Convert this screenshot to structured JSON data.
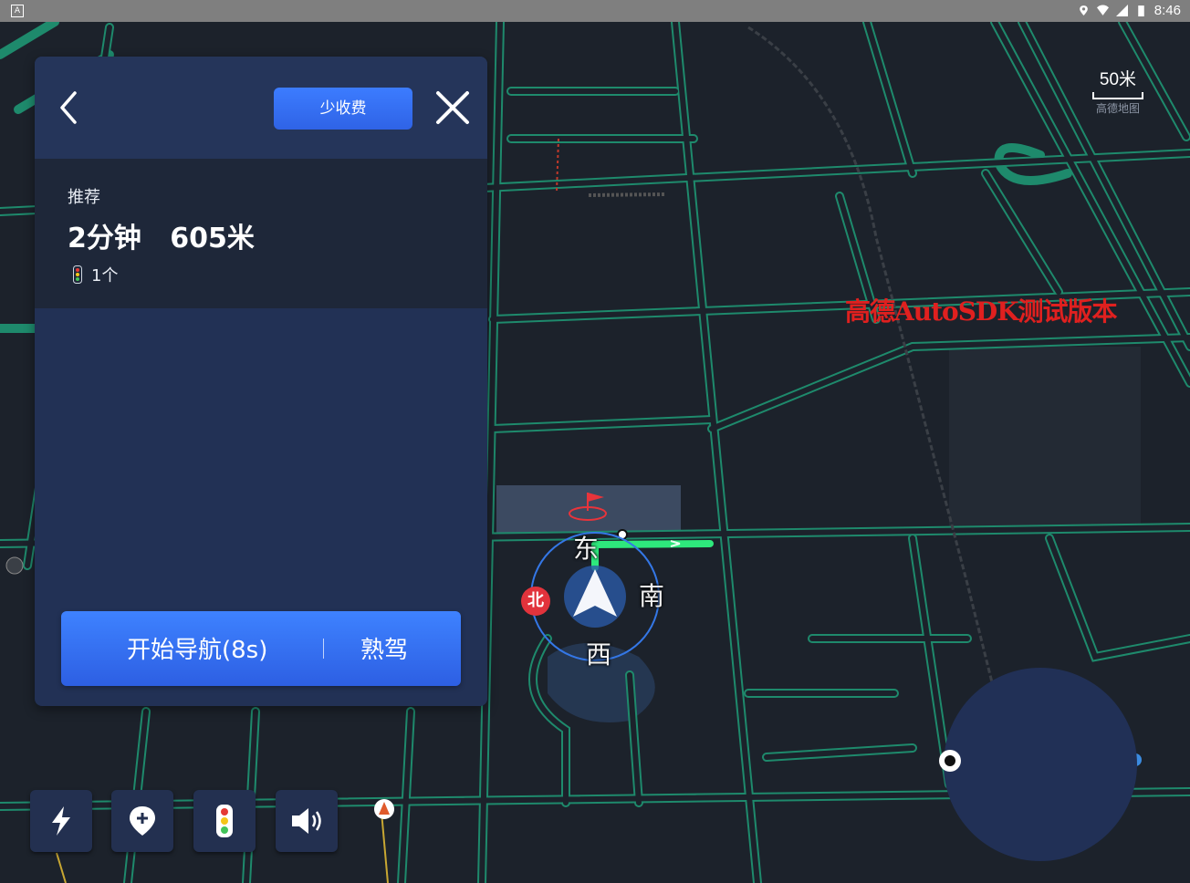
{
  "status_bar": {
    "time": "8:46",
    "icons": [
      "location-icon",
      "wifi-icon",
      "signal-icon",
      "battery-icon"
    ]
  },
  "route_panel": {
    "toll_option": "少收费",
    "route": {
      "tag": "推荐",
      "duration": "2分钟",
      "distance": "605米",
      "traffic_lights": "1个"
    },
    "nav_button": {
      "start_label": "开始导航(8s)",
      "familiar_label": "熟驾"
    }
  },
  "map": {
    "scale_value": "50米",
    "brand": "高德地图",
    "watermark": "高德AutoSDK测试版本",
    "compass": {
      "north": "北",
      "east": "东",
      "south": "南",
      "west": "西"
    },
    "colors": {
      "road": "#1f8b6e",
      "route": "#2ee87c",
      "background": "#1b222b"
    }
  },
  "toolbar": [
    "lightning-icon",
    "add-poi-icon",
    "traffic-light-icon",
    "volume-icon"
  ]
}
